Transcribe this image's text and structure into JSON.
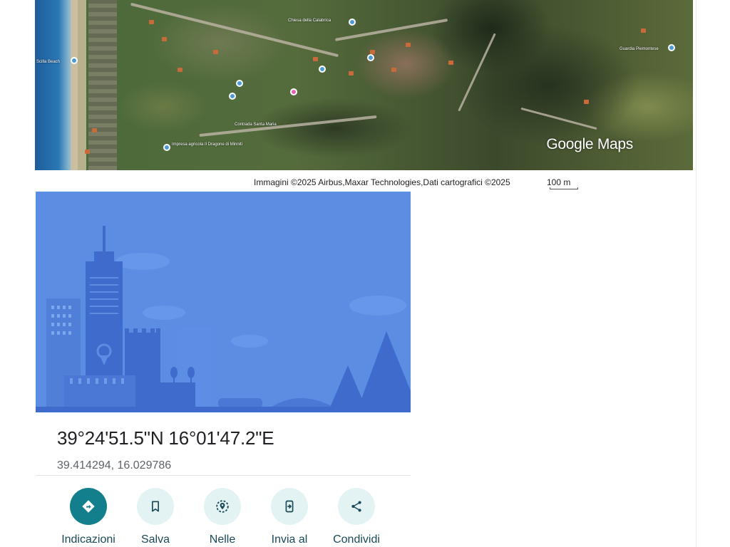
{
  "map": {
    "logo": "Google Maps",
    "labels": [
      "Chiesa della Calabrica",
      "Scilla Beach",
      "Impresa agricola Il Dragone di Minniti",
      "Contrada Santa Maria",
      "Guardia Piemontese"
    ]
  },
  "attribution": {
    "text": "Immagini ©2025 Airbus,Maxar Technologies,Dati cartografici ©2025",
    "scale": "100 m"
  },
  "place": {
    "dms": "39°24'51.5\"N 16°01'47.2\"E",
    "decimal": "39.414294, 16.029786"
  },
  "actions": [
    {
      "label": "Indicazioni",
      "icon": "directions-icon"
    },
    {
      "label": "Salva",
      "icon": "bookmark-icon"
    },
    {
      "label": "Nelle",
      "icon": "nearby-icon"
    },
    {
      "label": "Invia al",
      "icon": "send-to-phone-icon"
    },
    {
      "label": "Condividi",
      "icon": "share-icon"
    }
  ],
  "colors": {
    "primary_action": "#137e8c",
    "action_circle": "#e3f3f4",
    "illustration_sky": "#5b8de3"
  }
}
